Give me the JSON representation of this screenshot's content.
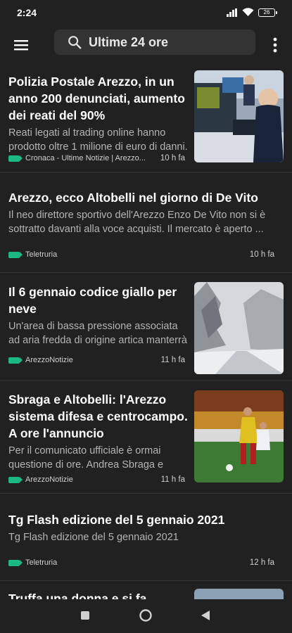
{
  "status": {
    "time": "2:24",
    "battery": "26"
  },
  "search": {
    "label": "Ultime 24 ore"
  },
  "articles": [
    {
      "title": "Polizia Postale Arezzo, in un anno 200 denunciati, aumento dei reati del 90%",
      "snippet": "Reati legati al trading online hanno prodotto oltre 1 milione di euro di danni.",
      "source": "Cronaca - Ultime Notizie | Arezzo...",
      "age": "10 h fa",
      "image": "police-office-photo"
    },
    {
      "title": "Arezzo, ecco Altobelli nel giorno di De Vito",
      "snippet": "Il neo direttore sportivo dell'Arezzo Enzo De Vito non si è sottratto davanti alla voce acquisti. Il mercato è aperto ...",
      "source": "Teletruria",
      "age": "10 h fa"
    },
    {
      "title": "Il 6 gennaio codice giallo per neve",
      "snippet": "Un'area di bassa pressione associata ad aria fredda di origine artica manterrà",
      "source": "ArezzoNotizie",
      "age": "11 h fa",
      "image": "snowy-road-photo"
    },
    {
      "title": "Sbraga e Altobelli: l'Arezzo sistema difesa e centrocampo. A ore l'annuncio",
      "snippet": "Per il comunicato ufficiale è ormai questione di ore. Andrea Sbraga e",
      "source": "ArezzoNotizie",
      "age": "11 h fa",
      "image": "football-match-photo"
    },
    {
      "title": "Tg Flash edizione del 5 gennaio 2021",
      "snippet": "Tg Flash edizione del 5 gennaio 2021",
      "source": "Teletruria",
      "age": "12 h fa"
    },
    {
      "title": "Truffa una donna e si fa"
    }
  ]
}
